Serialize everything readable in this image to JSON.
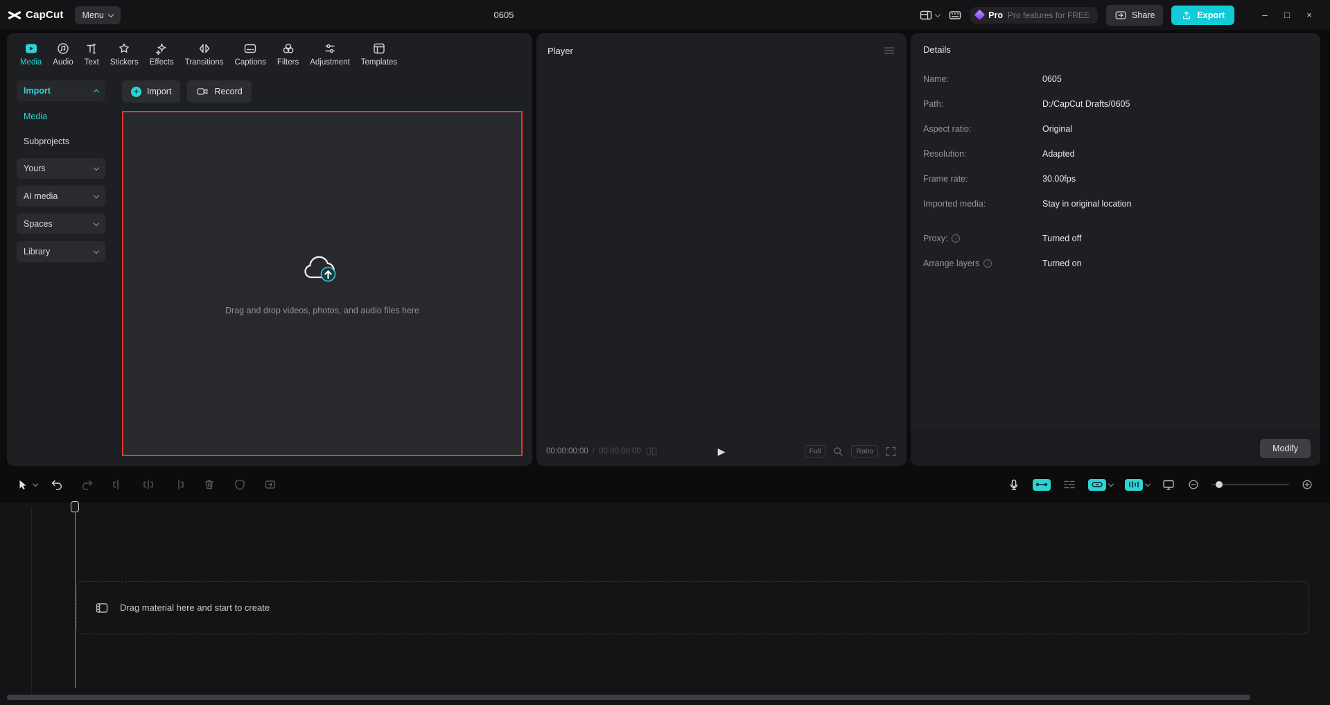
{
  "app": {
    "name": "CapCut"
  },
  "titlebar": {
    "menu_label": "Menu",
    "project_title": "0605",
    "pro_badge_label": "Pro",
    "pro_promo_text": "Pro features for FREE",
    "share_label": "Share",
    "export_label": "Export"
  },
  "media_panel": {
    "tabs": [
      {
        "label": "Media",
        "active": true
      },
      {
        "label": "Audio"
      },
      {
        "label": "Text"
      },
      {
        "label": "Stickers"
      },
      {
        "label": "Effects"
      },
      {
        "label": "Transitions"
      },
      {
        "label": "Captions"
      },
      {
        "label": "Filters"
      },
      {
        "label": "Adjustment"
      },
      {
        "label": "Templates"
      }
    ],
    "sidebar": {
      "import_section_label": "Import",
      "items": [
        {
          "label": "Media",
          "active": true
        },
        {
          "label": "Subprojects",
          "active": false
        }
      ],
      "groups": [
        {
          "label": "Yours"
        },
        {
          "label": "AI media"
        },
        {
          "label": "Spaces"
        },
        {
          "label": "Library"
        }
      ]
    },
    "import_button_label": "Import",
    "record_button_label": "Record",
    "dropzone_hint": "Drag and drop videos, photos, and audio files here"
  },
  "player_panel": {
    "title": "Player",
    "current_time": "00:00:00:00",
    "separator": "/",
    "total_time": "00:00:00:00",
    "full_button_label": "Full",
    "ratio_button_label": "Ratio"
  },
  "details_panel": {
    "title": "Details",
    "fields": [
      {
        "label": "Name:",
        "value": "0605"
      },
      {
        "label": "Path:",
        "value": "D:/CapCut Drafts/0605"
      },
      {
        "label": "Aspect ratio:",
        "value": "Original"
      },
      {
        "label": "Resolution:",
        "value": "Adapted"
      },
      {
        "label": "Frame rate:",
        "value": "30.00fps"
      },
      {
        "label": "Imported media:",
        "value": "Stay in original location"
      }
    ],
    "settings": [
      {
        "label": "Proxy:",
        "value": "Turned off"
      },
      {
        "label": "Arrange layers",
        "value": "Turned on"
      }
    ],
    "modify_button_label": "Modify"
  },
  "timeline": {
    "hint_text": "Drag material here and start to create"
  },
  "icons": {
    "minimize": "–",
    "maximize": "□",
    "close": "×",
    "plus": "+",
    "play": "▶",
    "info": "i"
  },
  "colors": {
    "accent": "#2BD4D4",
    "export_button": "#12CBD7",
    "pro_gem": "#8B5CF6",
    "highlight_border": "#E8352E",
    "panel_background": "#1E1F22"
  }
}
